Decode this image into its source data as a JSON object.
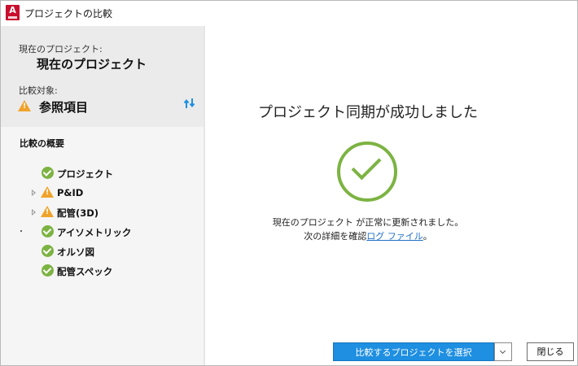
{
  "window": {
    "title": "プロジェクトの比較",
    "app_icon_letter": "A"
  },
  "sidebar": {
    "current_label": "現在のプロジェクト:",
    "current_value": "現在のプロジェクト",
    "compare_label": "比較対象:",
    "compare_value": "参照項目",
    "summary_title": "比較の概要",
    "tree": [
      {
        "label": "プロジェクト",
        "status": "ok",
        "expandable": false
      },
      {
        "label": "P&ID",
        "status": "warning",
        "expandable": true
      },
      {
        "label": "配管(3D)",
        "status": "warning",
        "expandable": true
      },
      {
        "label": "アイソメトリック",
        "status": "ok",
        "expandable": false
      },
      {
        "label": "オルソ図",
        "status": "ok",
        "expandable": false
      },
      {
        "label": "配管スペック",
        "status": "ok",
        "expandable": false
      }
    ]
  },
  "main": {
    "headline": "プロジェクト同期が成功しました",
    "message_line1": "現在のプロジェクト が正常に更新されました。",
    "message_line2_prefix": "次の詳細を確認",
    "log_link": "ログ ファイル",
    "message_line2_suffix": "。"
  },
  "footer": {
    "select_button": "比較するプロジェクトを選択",
    "close_button": "閉じる"
  },
  "colors": {
    "accent": "#1e8fe1",
    "success": "#7cb342",
    "warning": "#f0a32a",
    "link": "#1f6fc5"
  },
  "icons": {
    "success": "check-circle-icon",
    "warning": "warning-triangle-icon",
    "swap": "swap-arrows-icon",
    "expander": "chevron-right-icon",
    "dropdown": "chevron-down-icon"
  }
}
